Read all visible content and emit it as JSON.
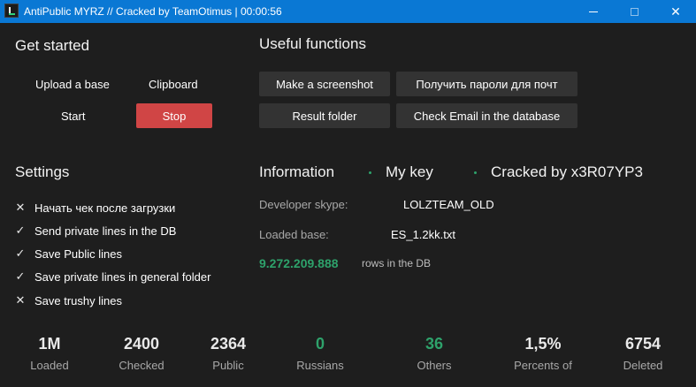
{
  "window": {
    "title": "AntiPublic MYRZ // Cracked by TeamOtimus | 00:00:56",
    "close_glyph": "✕"
  },
  "get_started": {
    "heading": "Get started",
    "upload_label": "Upload a base",
    "clipboard_label": "Clipboard",
    "start_label": "Start",
    "stop_label": "Stop",
    "stop_color": "#d04545"
  },
  "useful_functions": {
    "heading": "Useful functions",
    "screenshot_label": "Make a screenshot",
    "get_passwords_label": "Получить пароли для почт",
    "result_folder_label": "Result folder",
    "check_email_label": "Check Email in the database"
  },
  "settings": {
    "heading": "Settings",
    "items": [
      {
        "mark": "✕",
        "label": "Начать чек после загрузки",
        "checked": false
      },
      {
        "mark": "✓",
        "label": "Send private lines in the DB",
        "checked": true
      },
      {
        "mark": "✓",
        "label": "Save Public lines",
        "checked": true
      },
      {
        "mark": "✓",
        "label": "Save private lines in general folder",
        "checked": true
      },
      {
        "mark": "✕",
        "label": "Save trushy lines",
        "checked": false
      }
    ]
  },
  "information": {
    "tab_information": "Information",
    "tab_my_key": "My key",
    "tab_cracked": "Cracked by x3R07YP3",
    "developer_key": "Developer skype:",
    "developer_value": "LOLZTEAM_OLD",
    "loaded_key": "Loaded base:",
    "loaded_value": "ES_1.2kk.txt",
    "rows_count": "9.272.209.888",
    "rows_suffix": "rows in the DB",
    "accent_color": "#2ea26b"
  },
  "stats": [
    {
      "value": "1M",
      "caption": "Loaded"
    },
    {
      "value": "2400",
      "caption": "Checked"
    },
    {
      "value": "2364",
      "caption": "Public"
    },
    {
      "value": "0",
      "caption": "Russians"
    },
    {
      "value": "36",
      "caption": "Others"
    },
    {
      "value": "1,5%",
      "caption": "Percents of"
    },
    {
      "value": "6754",
      "caption": "Deleted"
    }
  ]
}
